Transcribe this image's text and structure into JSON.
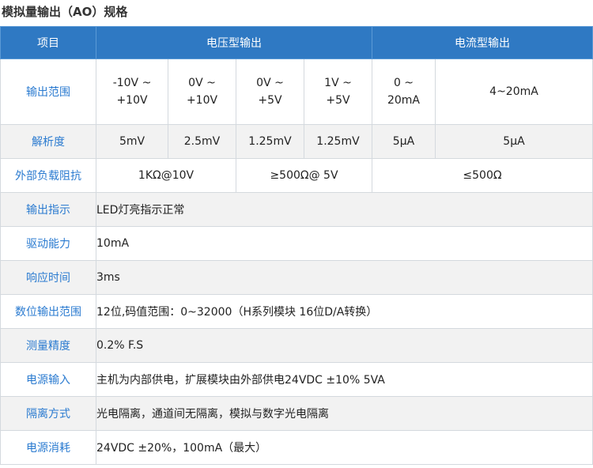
{
  "title": "模拟量输出（AO）规格",
  "header": {
    "item": "项目",
    "voltage_output": "电压型输出",
    "current_output": "电流型输出"
  },
  "rows": {
    "output_range": {
      "label": "输出范围",
      "values": [
        [
          "-10V ~",
          "+10V"
        ],
        [
          "0V ~",
          "+10V"
        ],
        [
          "0V ~",
          "+5V"
        ],
        [
          "1V ~",
          "+5V"
        ],
        [
          "0 ~",
          "20mA"
        ],
        [
          "4~20mA"
        ]
      ]
    },
    "resolution": {
      "label": "解析度",
      "values": [
        "5mV",
        "2.5mV",
        "1.25mV",
        "1.25mV",
        "5μA",
        "5μA"
      ]
    },
    "external_load": {
      "label": "外部负载阻抗",
      "values": [
        "1KΩ@10V",
        "≥500Ω@ 5V",
        "≤500Ω"
      ]
    },
    "output_indicator": {
      "label": "输出指示",
      "value": "LED灯亮指示正常"
    },
    "drive_capacity": {
      "label": "驱动能力",
      "value": "10mA"
    },
    "response_time": {
      "label": "响应时间",
      "value": "3ms"
    },
    "digital_output_range": {
      "label": "数位输出范围",
      "value": "12位,码值范围：0~32000（H系列模块 16位D/A转换）"
    },
    "accuracy": {
      "label": "测量精度",
      "value": "0.2% F.S"
    },
    "power_input": {
      "label": "电源输入",
      "value": "主机为内部供电，扩展模块由外部供电24VDC ±10%  5VA"
    },
    "isolation": {
      "label": "隔离方式",
      "value": "光电隔离，通道间无隔离，模拟与数字光电隔离"
    },
    "power_consumption": {
      "label": "电源消耗",
      "value": "24VDC ±20%，100mA（最大）"
    }
  }
}
